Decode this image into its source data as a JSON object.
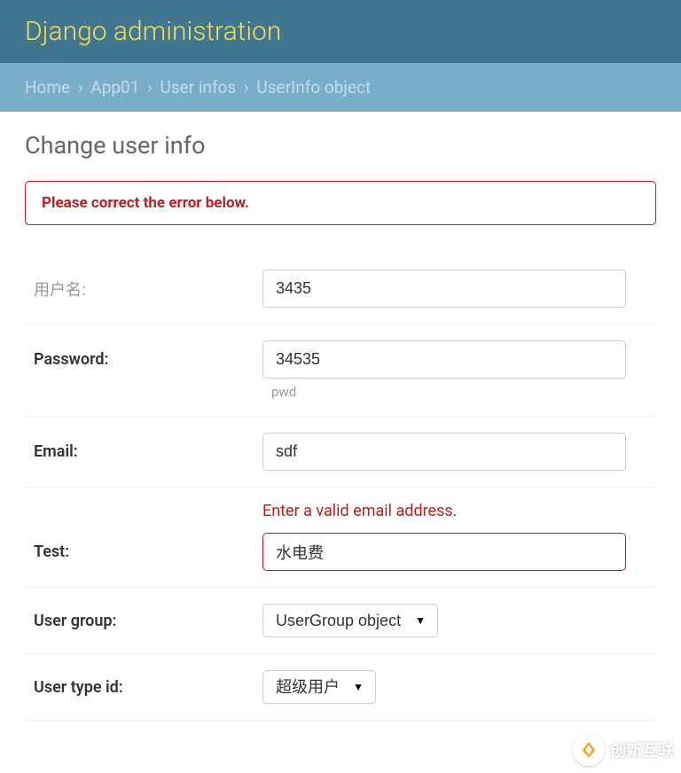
{
  "header": {
    "title": "Django administration"
  },
  "breadcrumbs": {
    "home": "Home",
    "app": "App01",
    "model": "User infos",
    "current": "UserInfo object"
  },
  "page": {
    "title": "Change user info"
  },
  "error_note": "Please correct the error below.",
  "fields": {
    "username": {
      "label": "用户名:",
      "value": "3435"
    },
    "password": {
      "label": "Password:",
      "value": "34535",
      "help": "pwd"
    },
    "email": {
      "label": "Email:",
      "value": "sdf"
    },
    "test": {
      "label": "Test:",
      "value": "水电费",
      "error": "Enter a valid email address."
    },
    "user_group": {
      "label": "User group:",
      "selected": "UserGroup object"
    },
    "user_type": {
      "label": "User type id:",
      "selected": "超级用户"
    }
  },
  "watermark": {
    "text": "创新互联"
  }
}
